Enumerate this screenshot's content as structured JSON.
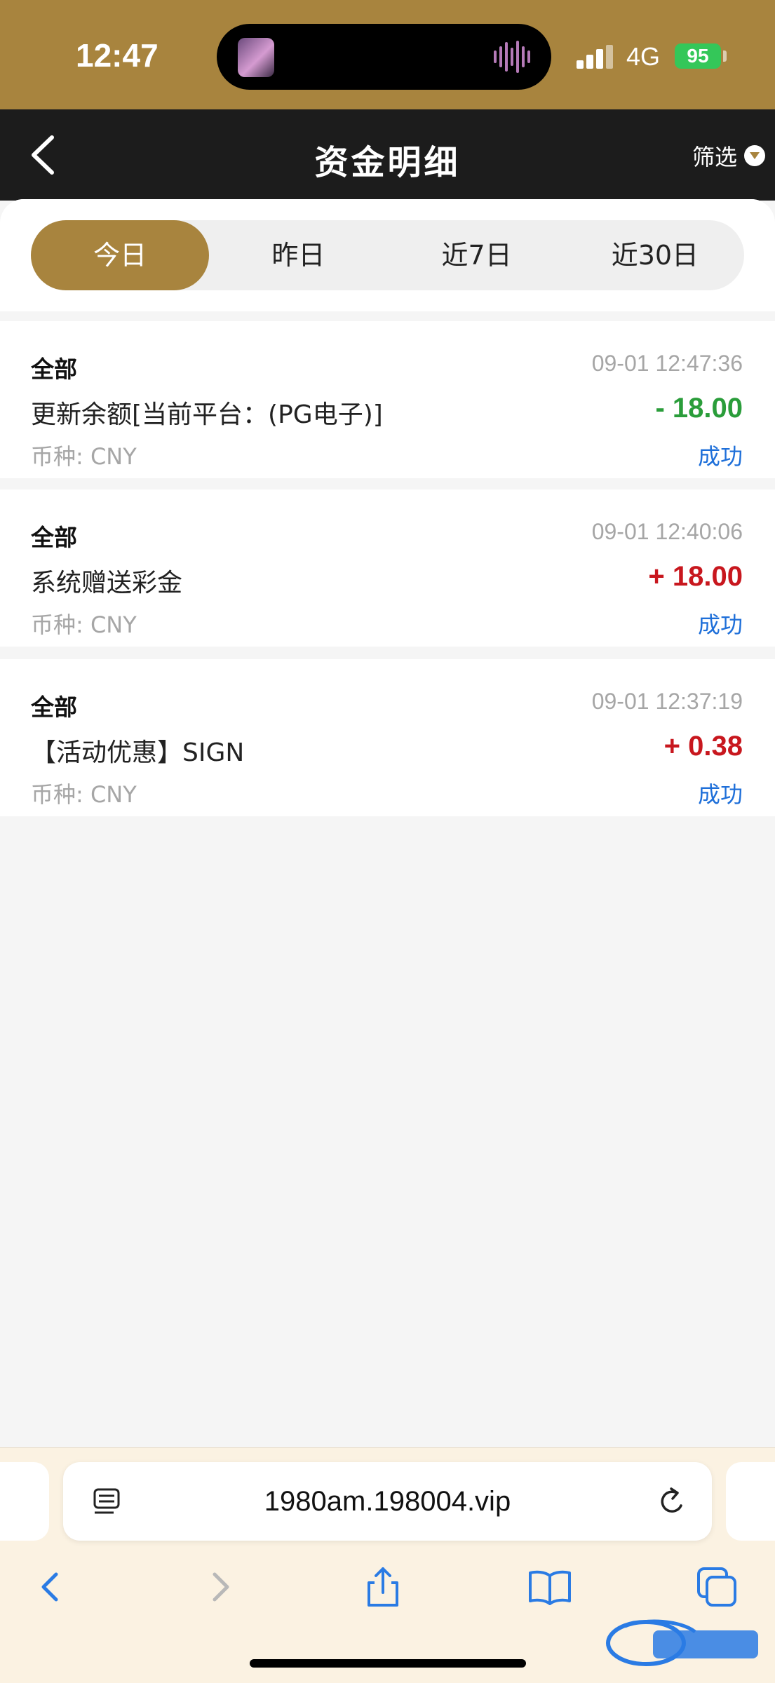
{
  "status": {
    "time": "12:47",
    "network": "4G",
    "battery": "95"
  },
  "header": {
    "title": "资金明细",
    "filter_label": "筛选"
  },
  "tabs": [
    {
      "label": "今日",
      "active": true
    },
    {
      "label": "昨日",
      "active": false
    },
    {
      "label": "近7日",
      "active": false
    },
    {
      "label": "近30日",
      "active": false
    }
  ],
  "records": [
    {
      "category": "全部",
      "time": "09-01 12:47:36",
      "description": "更新余额[当前平台：(PG电子)]",
      "amount": "- 18.00",
      "amount_color": "#2a9d3a",
      "currency": "币种: CNY",
      "status": "成功"
    },
    {
      "category": "全部",
      "time": "09-01 12:40:06",
      "description": "系统赠送彩金",
      "amount": "+ 18.00",
      "amount_color": "#c8171e",
      "currency": "币种: CNY",
      "status": "成功"
    },
    {
      "category": "全部",
      "time": "09-01 12:37:19",
      "description": "【活动优惠】SIGN",
      "amount": "+ 0.38",
      "amount_color": "#c8171e",
      "currency": "币种: CNY",
      "status": "成功"
    }
  ],
  "browser": {
    "url": "1980am.198004.vip"
  },
  "colors": {
    "accent": "#a8843e",
    "header_bg": "#1c1c1c",
    "success_blue": "#1e6fd9"
  },
  "icons": [
    "back-chevron-icon",
    "filter-dropdown-icon",
    "reader-icon",
    "reload-icon",
    "browser-back-icon",
    "browser-forward-icon",
    "share-icon",
    "bookmarks-icon",
    "tabs-icon"
  ]
}
